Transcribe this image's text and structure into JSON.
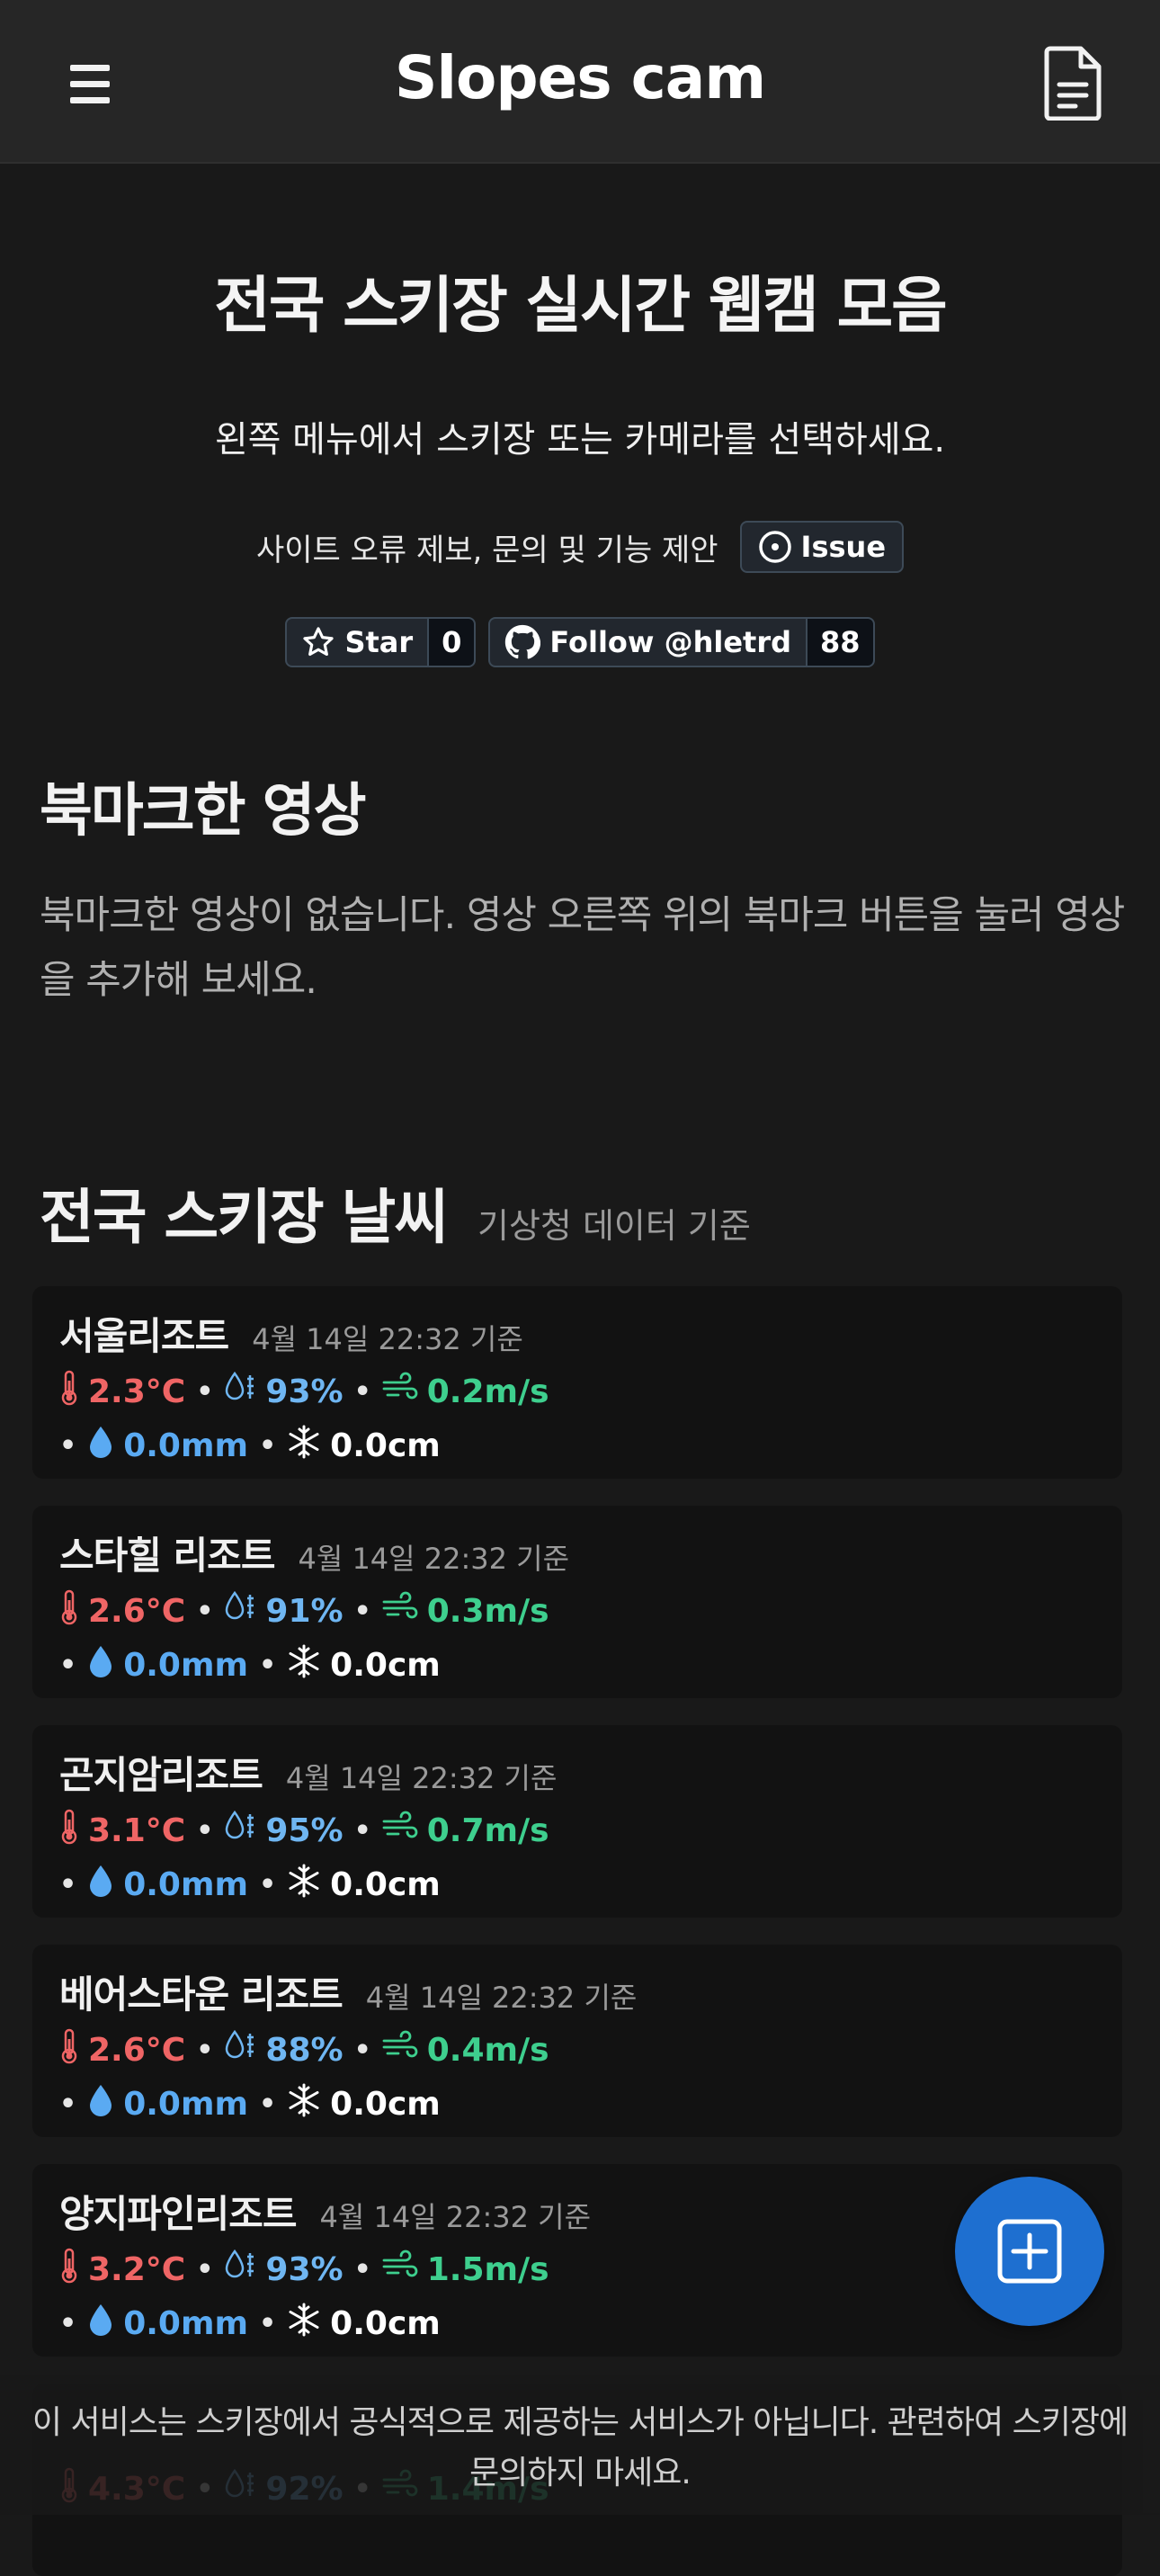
{
  "header": {
    "title": "Slopes cam"
  },
  "hero": {
    "title": "전국 스키장 실시간 웹캠 모음",
    "subtitle": "왼쪽 메뉴에서 스키장 또는 카메라를 선택하세요.",
    "report_text": "사이트 오류 제보, 문의 및 기능 제안",
    "issue_label": "Issue"
  },
  "github": {
    "star_label": "Star",
    "star_count": "0",
    "follow_label": "Follow @hletrd",
    "follow_count": "88"
  },
  "bookmarks": {
    "title": "북마크한 영상",
    "empty_text": "북마크한 영상이 없습니다. 영상 오른쪽 위의 북마크 버튼을 눌러 영상을 추가해 보세요."
  },
  "weather": {
    "title": "전국 스키장 날씨",
    "source": "기상청 데이터 기준",
    "cards": [
      {
        "name": "서울리조트",
        "time": "4월 14일 22:32 기준",
        "temp": "2.3°C",
        "humidity": "93%",
        "wind": "0.2m/s",
        "rain": "0.0mm",
        "snow": "0.0cm"
      },
      {
        "name": "스타힐 리조트",
        "time": "4월 14일 22:32 기준",
        "temp": "2.6°C",
        "humidity": "91%",
        "wind": "0.3m/s",
        "rain": "0.0mm",
        "snow": "0.0cm"
      },
      {
        "name": "곤지암리조트",
        "time": "4월 14일 22:32 기준",
        "temp": "3.1°C",
        "humidity": "95%",
        "wind": "0.7m/s",
        "rain": "0.0mm",
        "snow": "0.0cm"
      },
      {
        "name": "베어스타운 리조트",
        "time": "4월 14일 22:32 기준",
        "temp": "2.6°C",
        "humidity": "88%",
        "wind": "0.4m/s",
        "rain": "0.0mm",
        "snow": "0.0cm"
      },
      {
        "name": "양지파인리조트",
        "time": "4월 14일 22:32 기준",
        "temp": "3.2°C",
        "humidity": "93%",
        "wind": "1.5m/s",
        "rain": "0.0mm",
        "snow": "0.0cm"
      },
      {
        "name": "",
        "time": "",
        "temp": "4.3°C",
        "humidity": "92%",
        "wind": "1.4m/s",
        "rain": "",
        "snow": ""
      }
    ]
  },
  "footer": {
    "notice": "이 서비스는 스키장에서 공식적으로 제공하는 서비스가 아닙니다. 관련하여 스키장에 문의하지 마세요."
  },
  "colors": {
    "temp": "#ef6565",
    "humidity": "#6fb6f2",
    "wind": "#3ecf8e",
    "rain": "#5aaaf2",
    "fab": "#1e6fd0"
  }
}
